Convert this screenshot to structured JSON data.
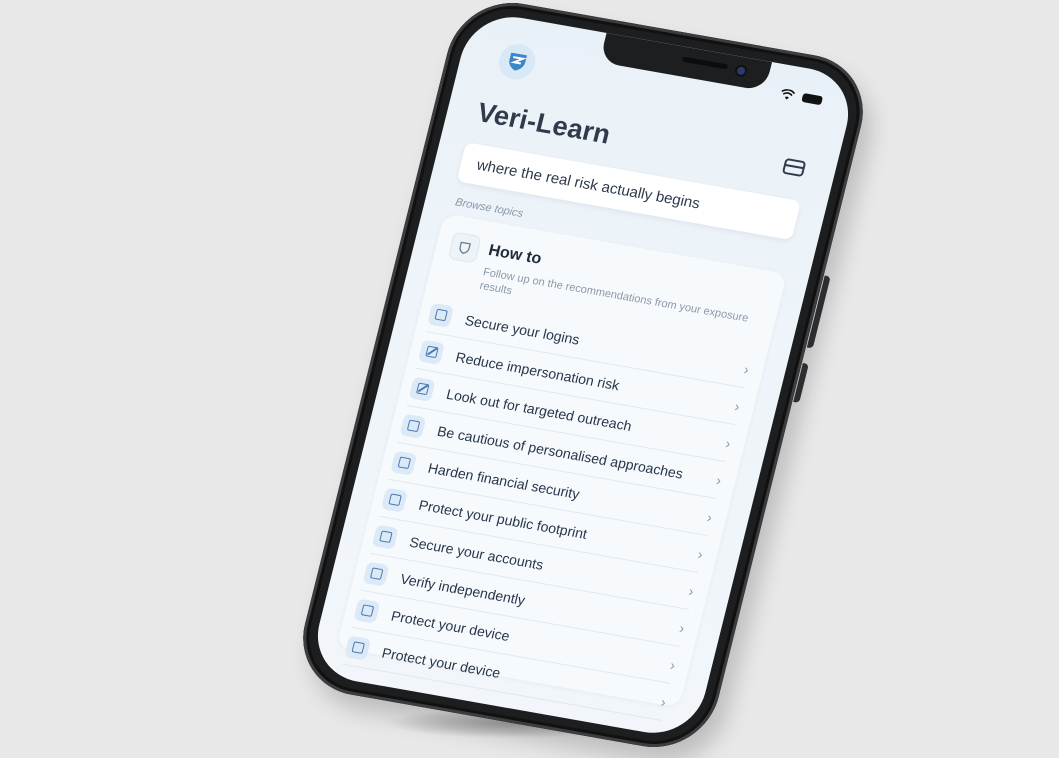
{
  "app": {
    "title": "Veri-Learn",
    "tagline": "where the real risk actually begins",
    "section_label": "Browse topics"
  },
  "how_to": {
    "title": "How to",
    "subtitle": "Follow up on the recommendations from your exposure results"
  },
  "items": [
    {
      "label": "Secure your logins",
      "icon": "square-icon"
    },
    {
      "label": "Reduce impersonation risk",
      "icon": "edit-square-icon"
    },
    {
      "label": "Look out for targeted outreach",
      "icon": "edit-square-icon"
    },
    {
      "label": "Be cautious of personalised approaches",
      "icon": "square-icon"
    },
    {
      "label": "Harden financial security",
      "icon": "square-icon"
    },
    {
      "label": "Protect your public footprint",
      "icon": "square-icon"
    },
    {
      "label": "Secure your accounts",
      "icon": "square-icon"
    },
    {
      "label": "Verify independently",
      "icon": "square-icon"
    },
    {
      "label": "Protect your device",
      "icon": "square-icon"
    },
    {
      "label": "Protect your device",
      "icon": "square-icon"
    }
  ],
  "chevron": "›",
  "colors": {
    "background": "#e8e8e8",
    "accent": "#4a78b0",
    "title": "#2f3b4c"
  }
}
